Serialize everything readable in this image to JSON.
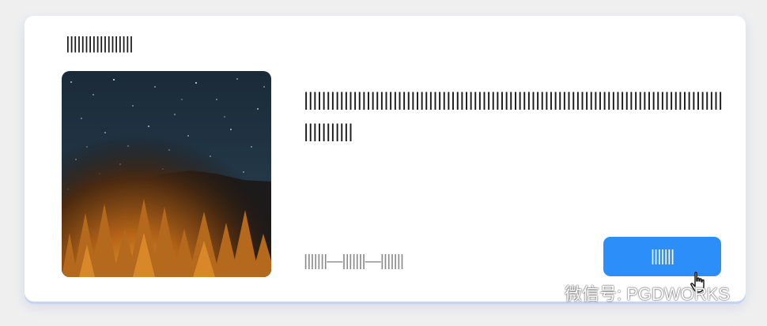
{
  "card": {
    "title": "||||||||||||||||||",
    "description": "|||||||||||||||||||||||||||||||||||||||||||||||||||||||||||||||||||||||||||||||||||||||||||||||||||||||||",
    "meta": "|||||||—|||||||—|||||||",
    "button_label": "|||||||",
    "image_icon": "night-sky-forest-photo"
  },
  "colors": {
    "background": "#efefef",
    "card": "#ffffff",
    "button": "#2b8ef9",
    "meta_text": "#8a8a8a"
  },
  "watermark": {
    "text": "微信号: PGDWORKS",
    "icon": "wechat-icon"
  }
}
